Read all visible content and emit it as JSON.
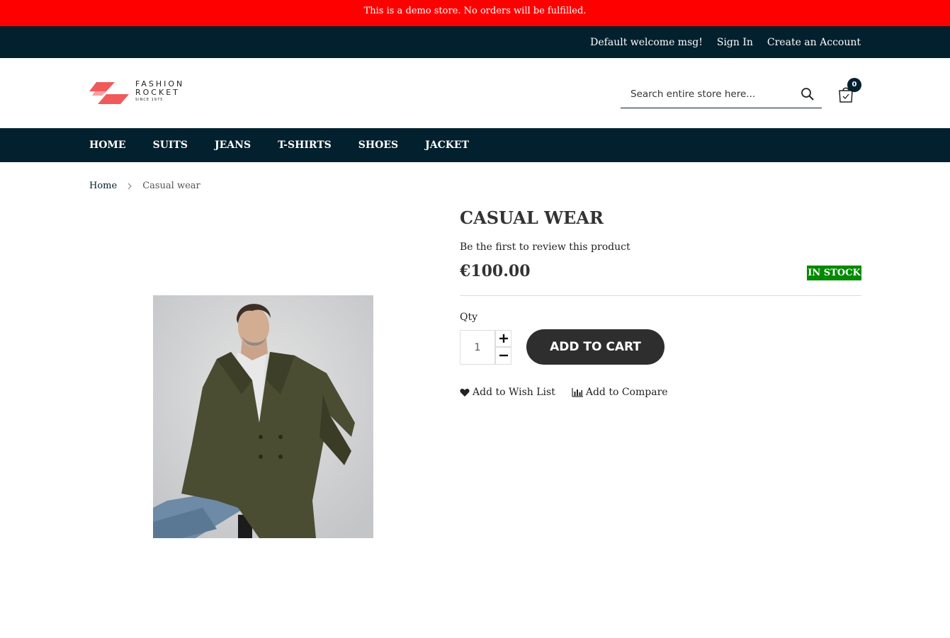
{
  "demo_notice": "This is a demo store. No orders will be fulfilled.",
  "top_links": {
    "welcome": "Default welcome msg!",
    "sign_in": "Sign In",
    "create_account": "Create an Account"
  },
  "logo": {
    "line1": "FASHION",
    "line2": "ROCKET",
    "line3": "SINCE 1975"
  },
  "search": {
    "placeholder": "Search entire store here...",
    "icon": "search-icon"
  },
  "cart": {
    "count": "0",
    "icon": "shopping-bag-icon"
  },
  "nav": {
    "items": [
      {
        "label": "HOME"
      },
      {
        "label": "SUITS"
      },
      {
        "label": "JEANS"
      },
      {
        "label": "T-SHIRTS"
      },
      {
        "label": "SHOES"
      },
      {
        "label": "JACKET"
      }
    ]
  },
  "breadcrumb": {
    "home": "Home",
    "current": "Casual wear"
  },
  "product": {
    "title": "CASUAL WEAR",
    "review_link": "Be the first to review this product",
    "price": "€100.00",
    "stock": "IN STOCK",
    "qty_label": "Qty",
    "qty_value": "1",
    "add_to_cart": "ADD TO CART",
    "wishlist": "Add to Wish List",
    "compare": "Add to Compare"
  },
  "colors": {
    "notice_bg": "#ff0000",
    "dark_navy": "#02202e",
    "logo_accent": "#f05a5a",
    "stock_green": "#008a00",
    "button_dark": "#2e2e2e"
  }
}
